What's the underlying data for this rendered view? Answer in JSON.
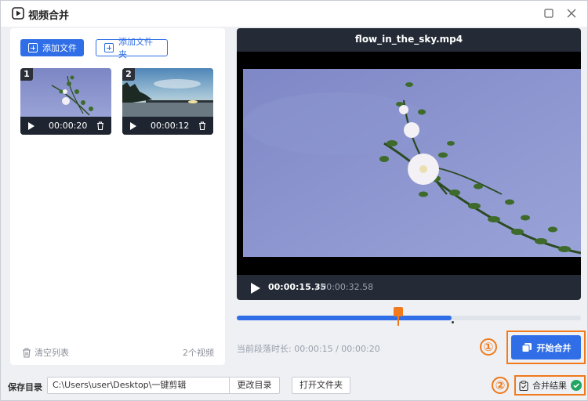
{
  "window": {
    "title": "视频合并"
  },
  "left_panel": {
    "add_file_label": "添加文件",
    "add_folder_label": "添加文件夹",
    "clips": [
      {
        "index": "1",
        "duration": "00:00:20"
      },
      {
        "index": "2",
        "duration": "00:00:12"
      }
    ],
    "clear_list_label": "清空列表",
    "count_label": "2个视频"
  },
  "player": {
    "filename": "flow_in_the_sky.mp4",
    "current_time": "00:00:15.35",
    "total_time": "/ 00:00:32.58"
  },
  "timeline": {
    "progress": 0.625,
    "segment_info": "当前段落时长: 00:00:15 / 00:00:20"
  },
  "actions": {
    "start_merge_label": "开始合并",
    "merge_result_label": "合并结果",
    "step_1": "①",
    "step_2": "②"
  },
  "bottom": {
    "save_dir_label": "保存目录",
    "save_path": "C:\\Users\\user\\Desktop\\一键剪辑",
    "change_dir_label": "更改目录",
    "open_folder_label": "打开文件夹"
  },
  "colors": {
    "accent": "#2f6ee6",
    "highlight": "#f07a1c",
    "player_bg": "#242b36"
  }
}
